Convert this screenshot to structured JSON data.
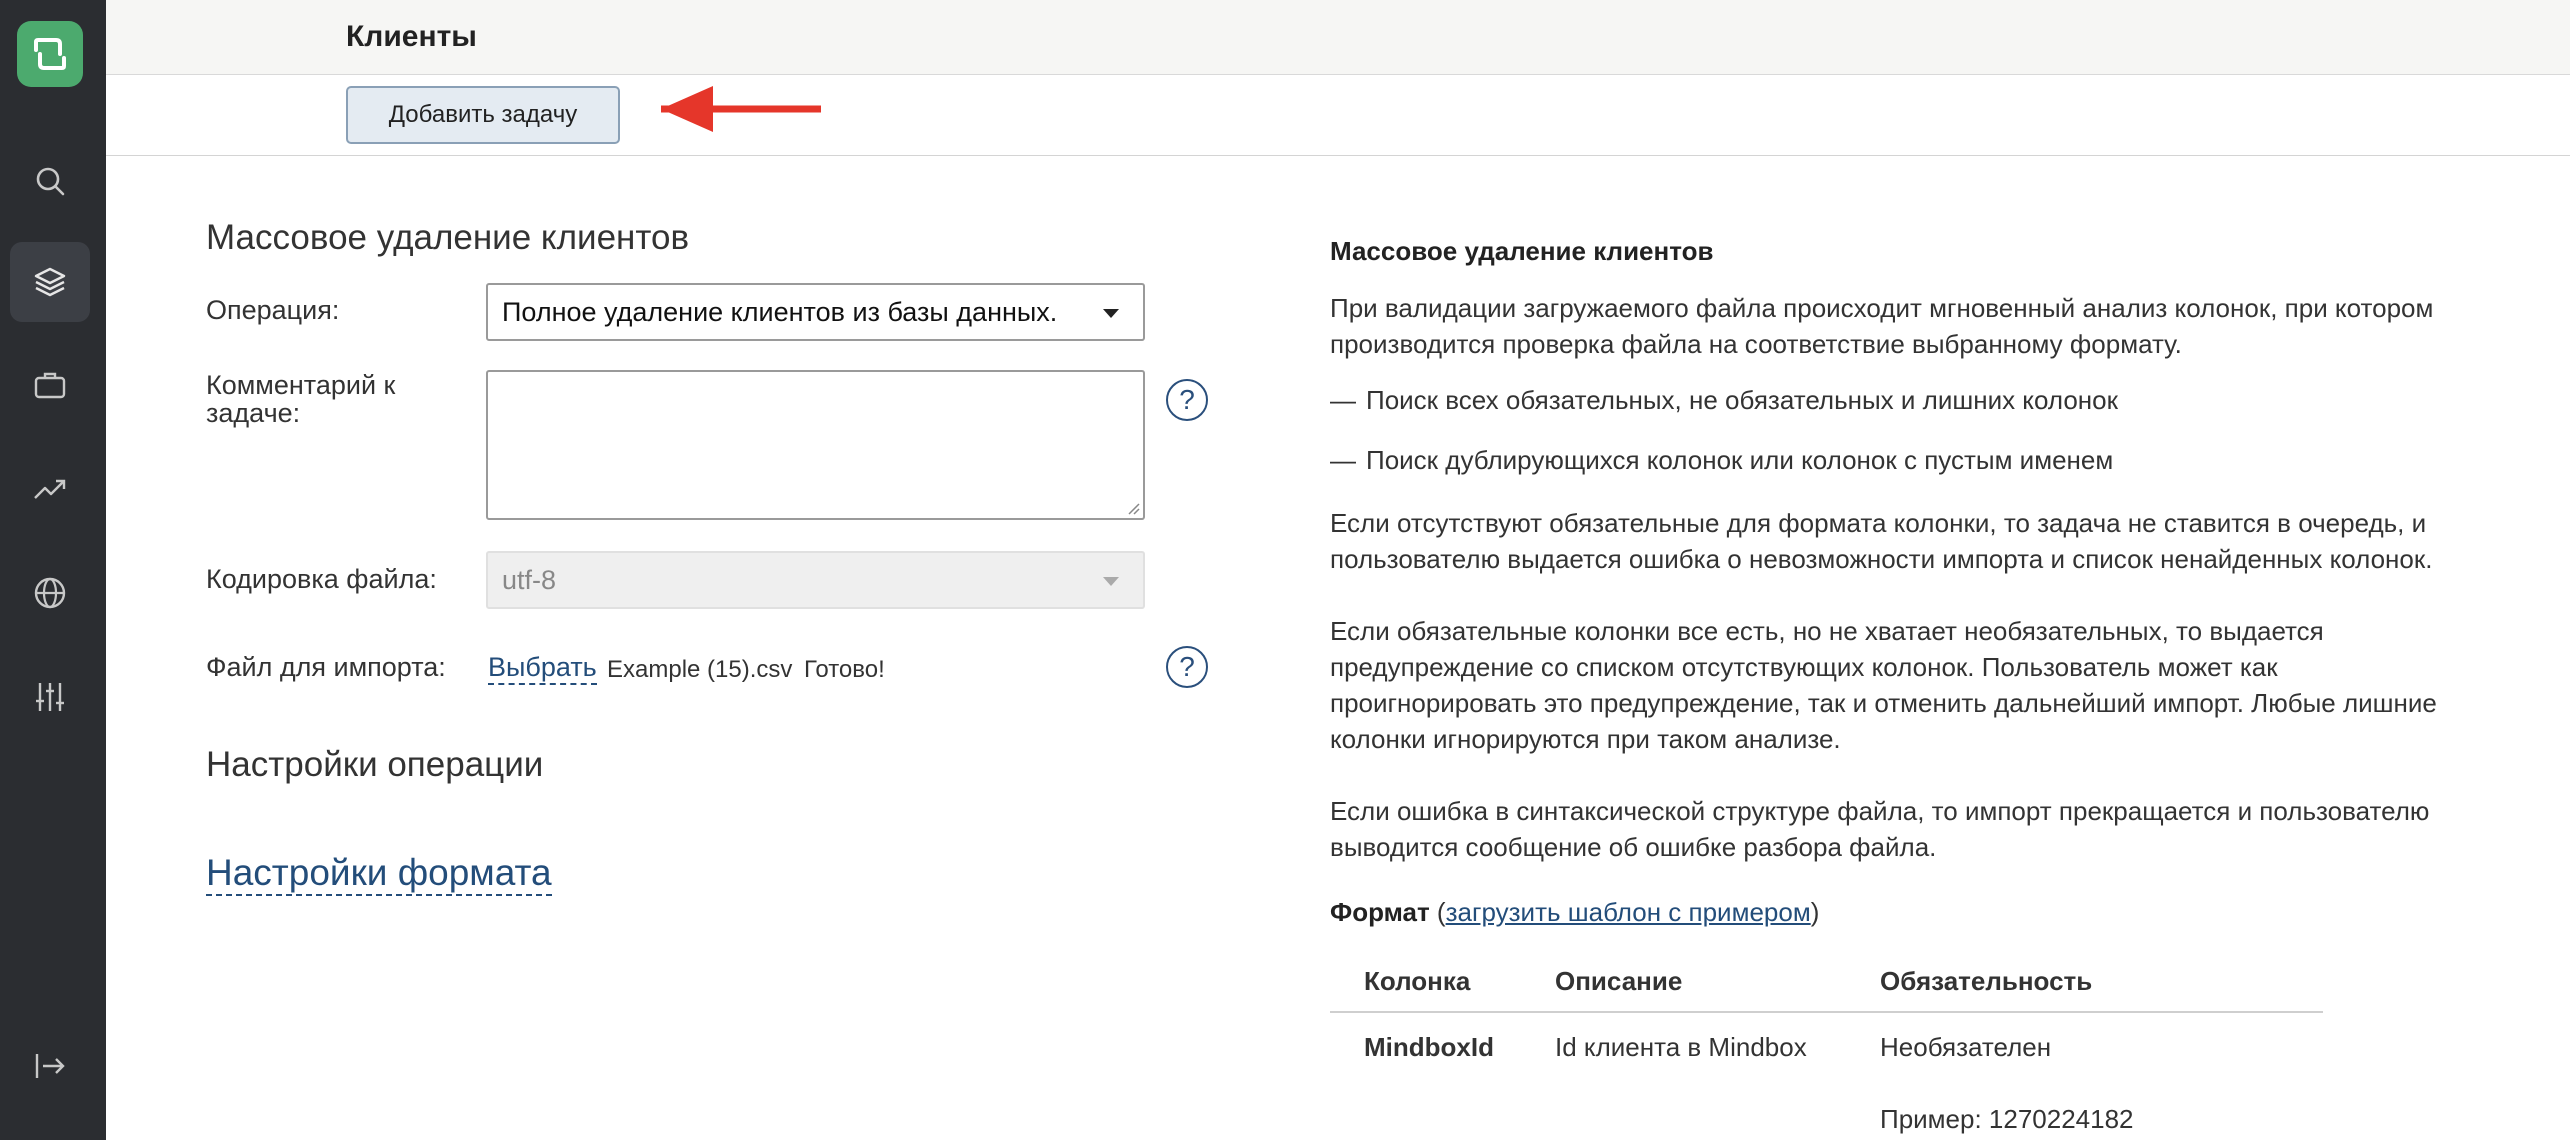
{
  "header": {
    "title": "Клиенты"
  },
  "toolbar": {
    "add_task_label": "Добавить задачу"
  },
  "sidebar": {
    "items": [
      {
        "icon": "search-icon"
      },
      {
        "icon": "layers-icon",
        "active": true
      },
      {
        "icon": "briefcase-icon"
      },
      {
        "icon": "trending-icon"
      },
      {
        "icon": "globe-icon"
      },
      {
        "icon": "sliders-icon"
      },
      {
        "icon": "logout-icon"
      }
    ]
  },
  "form": {
    "title": "Массовое удаление клиентов",
    "operation_label": "Операция:",
    "operation_value": "Полное удаление клиентов из базы данных.",
    "comment_label_line1": "Комментарий к",
    "comment_label_line2": "задаче:",
    "comment_value": "",
    "encoding_label": "Кодировка файла:",
    "encoding_value": "utf-8",
    "file_label": "Файл для импорта:",
    "file_choose": "Выбрать",
    "file_name": "Example (15).csv",
    "file_status": "Готово!",
    "help_glyph": "?",
    "operation_settings_title": "Настройки операции",
    "format_settings_link": "Настройки формата"
  },
  "doc": {
    "title": "Массовое удаление клиентов",
    "p1_line1": "При валидации загружаемого файла происходит мгновенный анализ колонок, при котором",
    "p1_line2": "производится проверка файла на соответствие выбранному формату.",
    "bullet_dash": "—",
    "bullet1": "Поиск всех обязательных, не обязательных и лишних колонок",
    "bullet2": "Поиск дублирующихся колонок или колонок с пустым именем",
    "p2_line1": "Если отсутствуют обязательные для формата колонки, то задача не ставится в очередь, и",
    "p2_line2": "пользователю выдается ошибка о невозможности импорта и список ненайденных колонок.",
    "p3_line1": "Если обязательные колонки все есть, но не хватает необязательных, то выдается",
    "p3_line2": "предупреждение со списком отсутствующих колонок. Пользователь может как",
    "p3_line3": "проигнорировать это предупреждение, так и отменить дальнейший импорт. Любые лишние",
    "p3_line4": "колонки игнорируются при таком анализе.",
    "p4_line1": "Если ошибка в синтаксической структуре файла, то импорт прекращается и пользователю",
    "p4_line2": "выводится сообщение об ошибке разбора файла.",
    "format_label": "Формат",
    "format_open": " (",
    "format_link": "загрузить шаблон с примером",
    "format_close": ")",
    "table": {
      "headers": [
        "Колонка",
        "Описание",
        "Обязательность"
      ],
      "rows": [
        {
          "column": "MindboxId",
          "description": "Id клиента в Mindbox",
          "required": "Необязателен",
          "example": "Пример: 1270224182"
        }
      ]
    }
  },
  "colors": {
    "sidebar_bg": "#2b2d31",
    "logo": "#4caa6e",
    "link": "#234d7a",
    "arrow": "#e5362a"
  }
}
